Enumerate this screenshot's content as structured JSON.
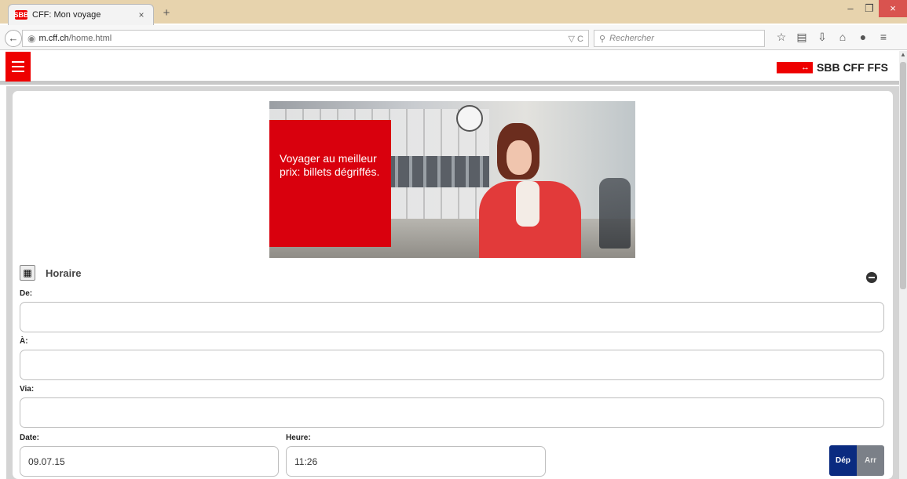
{
  "browser": {
    "tab_title": "CFF: Mon voyage",
    "tab_close": "×",
    "new_tab": "+",
    "favicon_text": "SBB",
    "url_domain": "m.cff.ch",
    "url_path": "/home.html",
    "url_actions": "▽ C",
    "search_placeholder": "Rechercher",
    "win_minimize": "–",
    "win_restore": "❐",
    "win_close": "×"
  },
  "header": {
    "brand_mark": "↔",
    "brand_text": "SBB CFF FFS"
  },
  "banner": {
    "text": "Voyager au meilleur prix: billets dégriffés."
  },
  "form": {
    "section_title": "Horaire",
    "from_label": "De:",
    "from_value": "",
    "to_label": "À:",
    "to_value": "",
    "via_label": "Via:",
    "via_value": "",
    "date_label": "Date:",
    "date_value": "09.07.15",
    "time_label": "Heure:",
    "time_value": "11:26",
    "dep_label": "Dép",
    "arr_label": "Arr"
  },
  "icons": {
    "back": "back-arrow-icon",
    "globe": "globe-icon",
    "search": "search-icon",
    "star": "bookmark-star-icon",
    "reading": "reading-list-icon",
    "download": "download-icon",
    "home": "home-icon",
    "chat": "chat-icon",
    "menu": "hamburger-menu-icon"
  },
  "colors": {
    "brand_red": "#e00000",
    "dep_blue": "#0a2b80",
    "arr_gray": "#7b8088"
  }
}
